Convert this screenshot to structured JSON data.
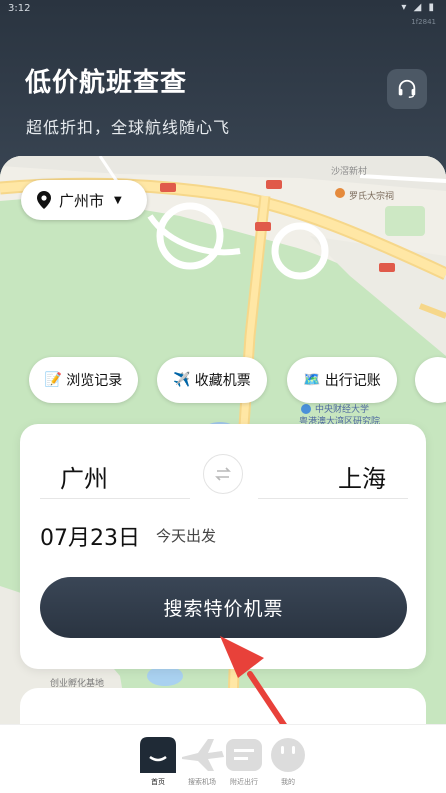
{
  "status_bar": {
    "time": "3:12",
    "icons": "▾ ◢ ▮",
    "sub": "1f2841"
  },
  "header": {
    "title": "低价航班查查",
    "subtitle": "超低折扣，全球航线随心飞",
    "support_icon": "headset-icon"
  },
  "map": {
    "city_chip": {
      "city": "广州市",
      "pin_icon": "location-pin-icon",
      "caret_icon": "caret-down-icon"
    },
    "labels": [
      "罗氏大宗祠",
      "沙滘新村",
      "中央财经大学",
      "粤港澳大湾区研究院",
      "创业孵化基地"
    ],
    "road_badges": [
      "S81",
      "S8",
      "G3"
    ]
  },
  "quick_actions": [
    {
      "icon": "📝",
      "label": "浏览记录"
    },
    {
      "icon": "✈️",
      "label": "收藏机票"
    },
    {
      "icon": "🗺️",
      "label": "出行记账"
    }
  ],
  "search": {
    "from_city": "广州",
    "to_city": "上海",
    "swap_icon": "swap-icon",
    "date": "07月23日",
    "date_note": "今天出发",
    "button_label": "搜索特价机票"
  },
  "tabbar": {
    "tabs": [
      {
        "label": "首页",
        "icon": "home-face-icon",
        "active": true
      },
      {
        "label": "搜索机场",
        "icon": "plane-icon",
        "active": false
      },
      {
        "label": "附近出行",
        "icon": "list-icon",
        "active": false
      },
      {
        "label": "我的",
        "icon": "smile-icon",
        "active": false
      }
    ]
  },
  "colors": {
    "header_bg": "#2f3a47",
    "button_bg": "#2f3a47",
    "map_green": "#c7e6bf",
    "arrow_red": "#e8413a"
  }
}
